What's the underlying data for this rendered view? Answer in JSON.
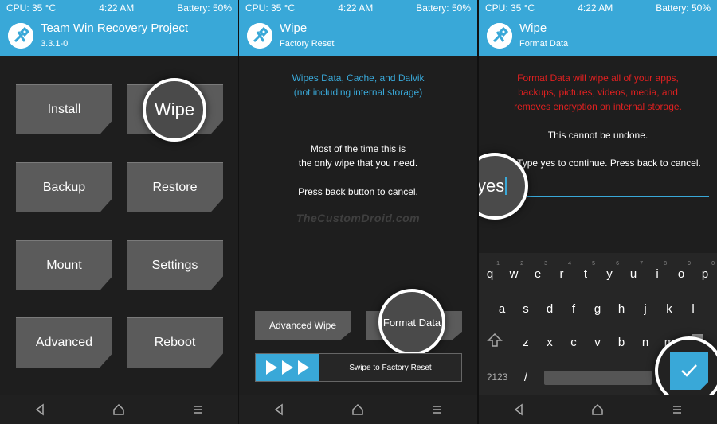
{
  "status": {
    "cpu": "CPU: 35 °C",
    "time": "4:22 AM",
    "battery": "Battery: 50%"
  },
  "panel1": {
    "title": "Team Win Recovery Project",
    "version": "3.3.1-0",
    "buttons": [
      "Install",
      "Wipe",
      "Backup",
      "Restore",
      "Mount",
      "Settings",
      "Advanced",
      "Reboot"
    ],
    "highlight": "Wipe"
  },
  "panel2": {
    "title": "Wipe",
    "subtitle": "Factory Reset",
    "info_line1": "Wipes Data, Cache, and Dalvik",
    "info_line2": "(not including internal storage)",
    "body_line1": "Most of the time this is",
    "body_line2": "the only wipe that you need.",
    "body_line3": "Press back button to cancel.",
    "watermark": "TheCustomDroid.com",
    "advanced_wipe": "Advanced Wipe",
    "format_data": "Format Data",
    "swipe_label": "Swipe to Factory Reset"
  },
  "panel3": {
    "title": "Wipe",
    "subtitle": "Format Data",
    "warn_line1": "Format Data will wipe all of your apps,",
    "warn_line2": "backups, pictures, videos, media, and",
    "warn_line3": "removes encryption on internal storage.",
    "cannot_undo": "This cannot be undone.",
    "prompt": "Type yes to continue.  Press back to cancel.",
    "input_value": "yes",
    "keyboard": {
      "row1": [
        "q",
        "w",
        "e",
        "r",
        "t",
        "y",
        "u",
        "i",
        "o",
        "p"
      ],
      "row1_hints": [
        "1",
        "2",
        "3",
        "4",
        "5",
        "6",
        "7",
        "8",
        "9",
        "0"
      ],
      "row2": [
        "a",
        "s",
        "d",
        "f",
        "g",
        "h",
        "j",
        "k",
        "l"
      ],
      "row3": [
        "z",
        "x",
        "c",
        "v",
        "b",
        "n",
        "m"
      ],
      "symbols_key": "?123",
      "slash_key": "/"
    }
  },
  "colors": {
    "accent": "#39a8d8",
    "warning": "#e02020",
    "background": "#1e1e1e",
    "button": "#5b5b5b"
  }
}
